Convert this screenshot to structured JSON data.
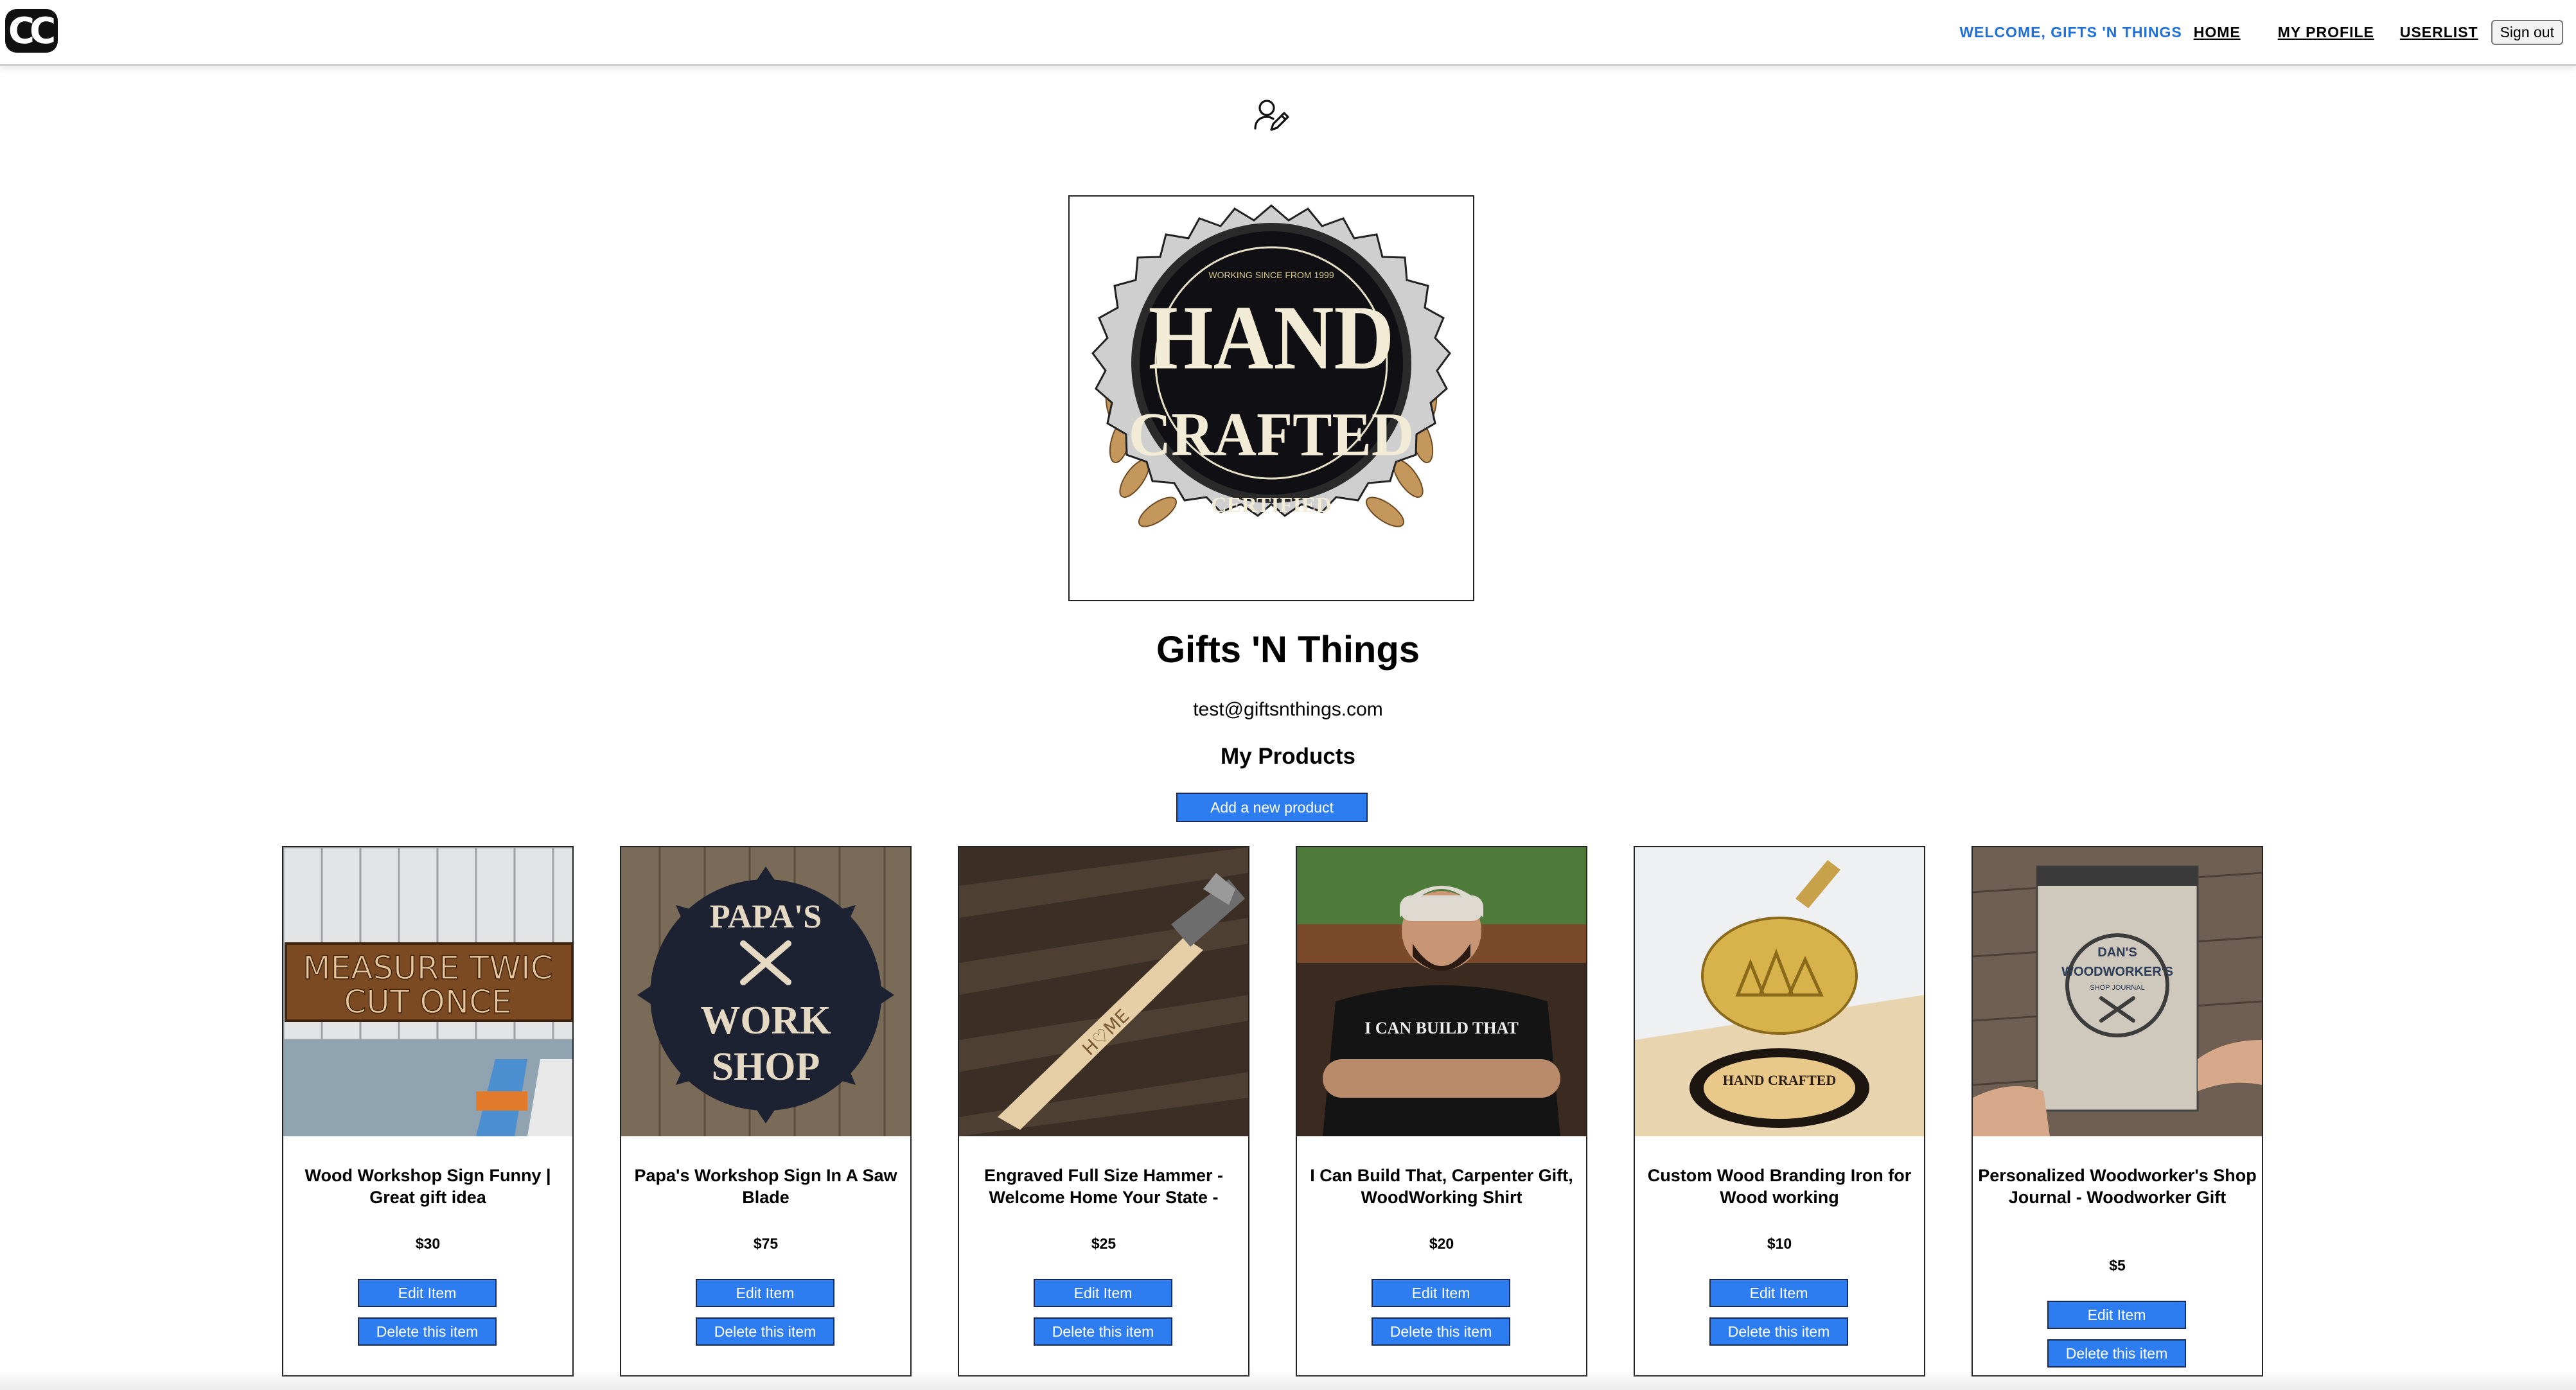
{
  "header": {
    "logo_text": "CC",
    "welcome": "WELCOME, GIFTS 'N THINGS",
    "nav": {
      "home": "HOME",
      "my_profile": "MY PROFILE",
      "userlist": "USERLIST"
    },
    "sign_out": "Sign out"
  },
  "profile": {
    "icon": "user-edit-icon",
    "image_text": {
      "top": "WORKING SINCE FROM 1999",
      "line1": "HAND",
      "line2": "CRAFTED",
      "badge": "CERTIFIED"
    },
    "name": "Gifts 'N Things",
    "email": "test@giftsnthings.com",
    "products_heading": "My Products",
    "add_button": "Add a new product"
  },
  "products": [
    {
      "title": "Wood Workshop Sign Funny | Great gift idea",
      "price": "$30",
      "edit": "Edit Item",
      "delete": "Delete this item",
      "image_text": [
        "MEASURE TWIC",
        "CUT ONCE"
      ]
    },
    {
      "title": "Papa's Workshop Sign In A Saw Blade",
      "price": "$75",
      "edit": "Edit Item",
      "delete": "Delete this item",
      "image_text": [
        "PAPA'S",
        "WORK",
        "SHOP"
      ]
    },
    {
      "title": "Engraved Full Size Hammer - Welcome Home Your State -",
      "price": "$25",
      "edit": "Edit Item",
      "delete": "Delete this item",
      "image_text": [
        "H♡ME"
      ]
    },
    {
      "title": "I Can Build That, Carpenter Gift, WoodWorking Shirt",
      "price": "$20",
      "edit": "Edit Item",
      "delete": "Delete this item",
      "image_text": [
        "I CAN BUILD THAT"
      ]
    },
    {
      "title": "Custom Wood Branding Iron for Wood working",
      "price": "$10",
      "edit": "Edit Item",
      "delete": "Delete this item",
      "image_text": [
        "HAND CRAFTED"
      ]
    },
    {
      "title": "Personalized Woodworker's Shop Journal - Woodworker Gift",
      "price": "$5",
      "edit": "Edit Item",
      "delete": "Delete this item",
      "image_text": [
        "DAN'S",
        "WOODWORKER'S",
        "SHOP JOURNAL"
      ]
    }
  ]
}
